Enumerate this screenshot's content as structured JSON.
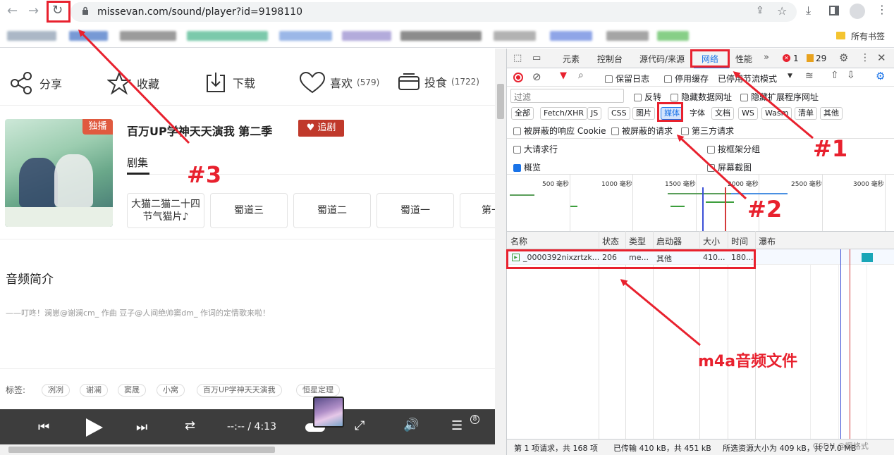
{
  "browser": {
    "url": "missevan.com/sound/player?id=9198110",
    "bookmarks_all": "所有书签"
  },
  "page": {
    "actions": [
      {
        "label": "分享",
        "icon": "share-icon"
      },
      {
        "label": "收藏",
        "icon": "star-icon"
      },
      {
        "label": "下载",
        "icon": "download-icon"
      },
      {
        "label": "喜欢",
        "count": "(579)",
        "icon": "heart-icon"
      },
      {
        "label": "投食",
        "count": "(1722)",
        "icon": "feed-icon"
      }
    ],
    "cover_badge": "独播",
    "drama_title": "百万UP学神天天演我 第二季",
    "follow_button": "♥ 追剧",
    "episodes_tab": "剧集",
    "episodes": [
      "大猫二猫二十四节气猫片♪",
      "蜀道三",
      "蜀道二",
      "蜀道一",
      "第一"
    ],
    "intro_heading": "音频简介",
    "intro_text": "——叮咚！澜崽@谢澜cm_ 作曲 豆子@人间绝帅窦dm_ 作词的定情歌来啦！",
    "tags_label": "标签:",
    "tags": [
      "冽冽",
      "谢澜",
      "窦晟",
      "小窝",
      "百万UP学神天天演我",
      "恒星定理"
    ],
    "player_time": "--:-- / 4:13",
    "playlist_count": "8"
  },
  "devtools": {
    "tabs": [
      "元素",
      "控制台",
      "源代码/来源",
      "网络",
      "性能"
    ],
    "active_tab": "网络",
    "error_count": "1",
    "warning_count": "29",
    "preserve_log": "保留日志",
    "disable_cache": "停用缓存",
    "throttle": "已停用节流模式",
    "filter_placeholder": "过滤",
    "invert": "反转",
    "hide_data_urls": "隐藏数据网址",
    "hide_ext_urls": "隐藏扩展程序网址",
    "type_filters": [
      "全部",
      "Fetch/XHR",
      "JS",
      "CSS",
      "图片",
      "媒体",
      "字体",
      "文档",
      "WS",
      "Wasm",
      "清单",
      "其他"
    ],
    "blocked_cookies": "被屏蔽的响应 Cookie",
    "blocked_requests": "被屏蔽的请求",
    "third_party": "第三方请求",
    "big_rows": "大请求行",
    "group_by_frame": "按框架分组",
    "overview": "概览",
    "screenshots": "屏幕截图",
    "timeline_ticks": [
      "500 毫秒",
      "1000 毫秒",
      "1500 毫秒",
      "2000 毫秒",
      "2500 毫秒",
      "3000 毫秒"
    ],
    "columns": [
      "名称",
      "状态",
      "类型",
      "启动器",
      "大小",
      "时间",
      "瀑布"
    ],
    "row": {
      "name": "_0000392nixzrtzk...",
      "status": "206",
      "type": "me...",
      "initiator": "其他",
      "size": "410...",
      "time": "180..."
    },
    "status_bar": {
      "requests": "第 1 项请求，共 168 项",
      "transferred": "已传输 410 kB，共 451 kB",
      "resources": "所选资源大小为 409 kB，共 27.0 MB"
    }
  },
  "annotations": {
    "label1": "#1",
    "label2": "#2",
    "label3": "#3",
    "m4a": "m4a音频文件"
  },
  "watermark": "CSDN @瞬格式"
}
